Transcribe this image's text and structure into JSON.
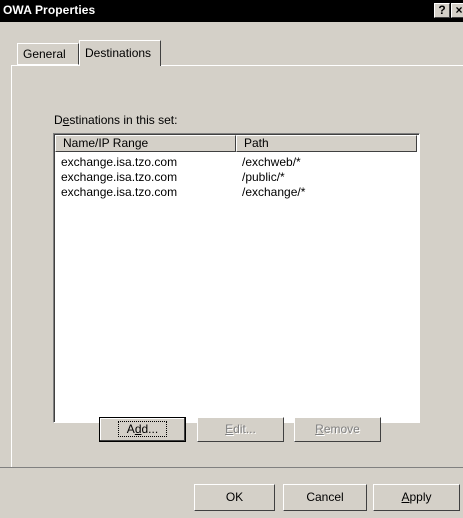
{
  "window": {
    "title": "OWA Properties",
    "help_glyph": "?",
    "close_glyph": "×"
  },
  "tabs": [
    {
      "label": "General"
    },
    {
      "label": "Destinations"
    }
  ],
  "destinations": {
    "label_prefix": "D",
    "label_mnemonic": "e",
    "label_rest": "stinations in this set:",
    "columns": [
      "Name/IP Range",
      "Path"
    ],
    "rows": [
      {
        "name": "exchange.isa.tzo.com",
        "path": "/exchweb/*"
      },
      {
        "name": "exchange.isa.tzo.com",
        "path": "/public/*"
      },
      {
        "name": "exchange.isa.tzo.com",
        "path": "/exchange/*"
      }
    ],
    "buttons": {
      "add": {
        "pre": "A",
        "mn": "d",
        "post": "d..."
      },
      "edit": {
        "pre": "",
        "mn": "E",
        "post": "dit..."
      },
      "remove": {
        "pre": "",
        "mn": "R",
        "post": "emove"
      }
    }
  },
  "footer": {
    "ok": "OK",
    "cancel": "Cancel",
    "apply_mn": "A",
    "apply_rest": "pply"
  }
}
